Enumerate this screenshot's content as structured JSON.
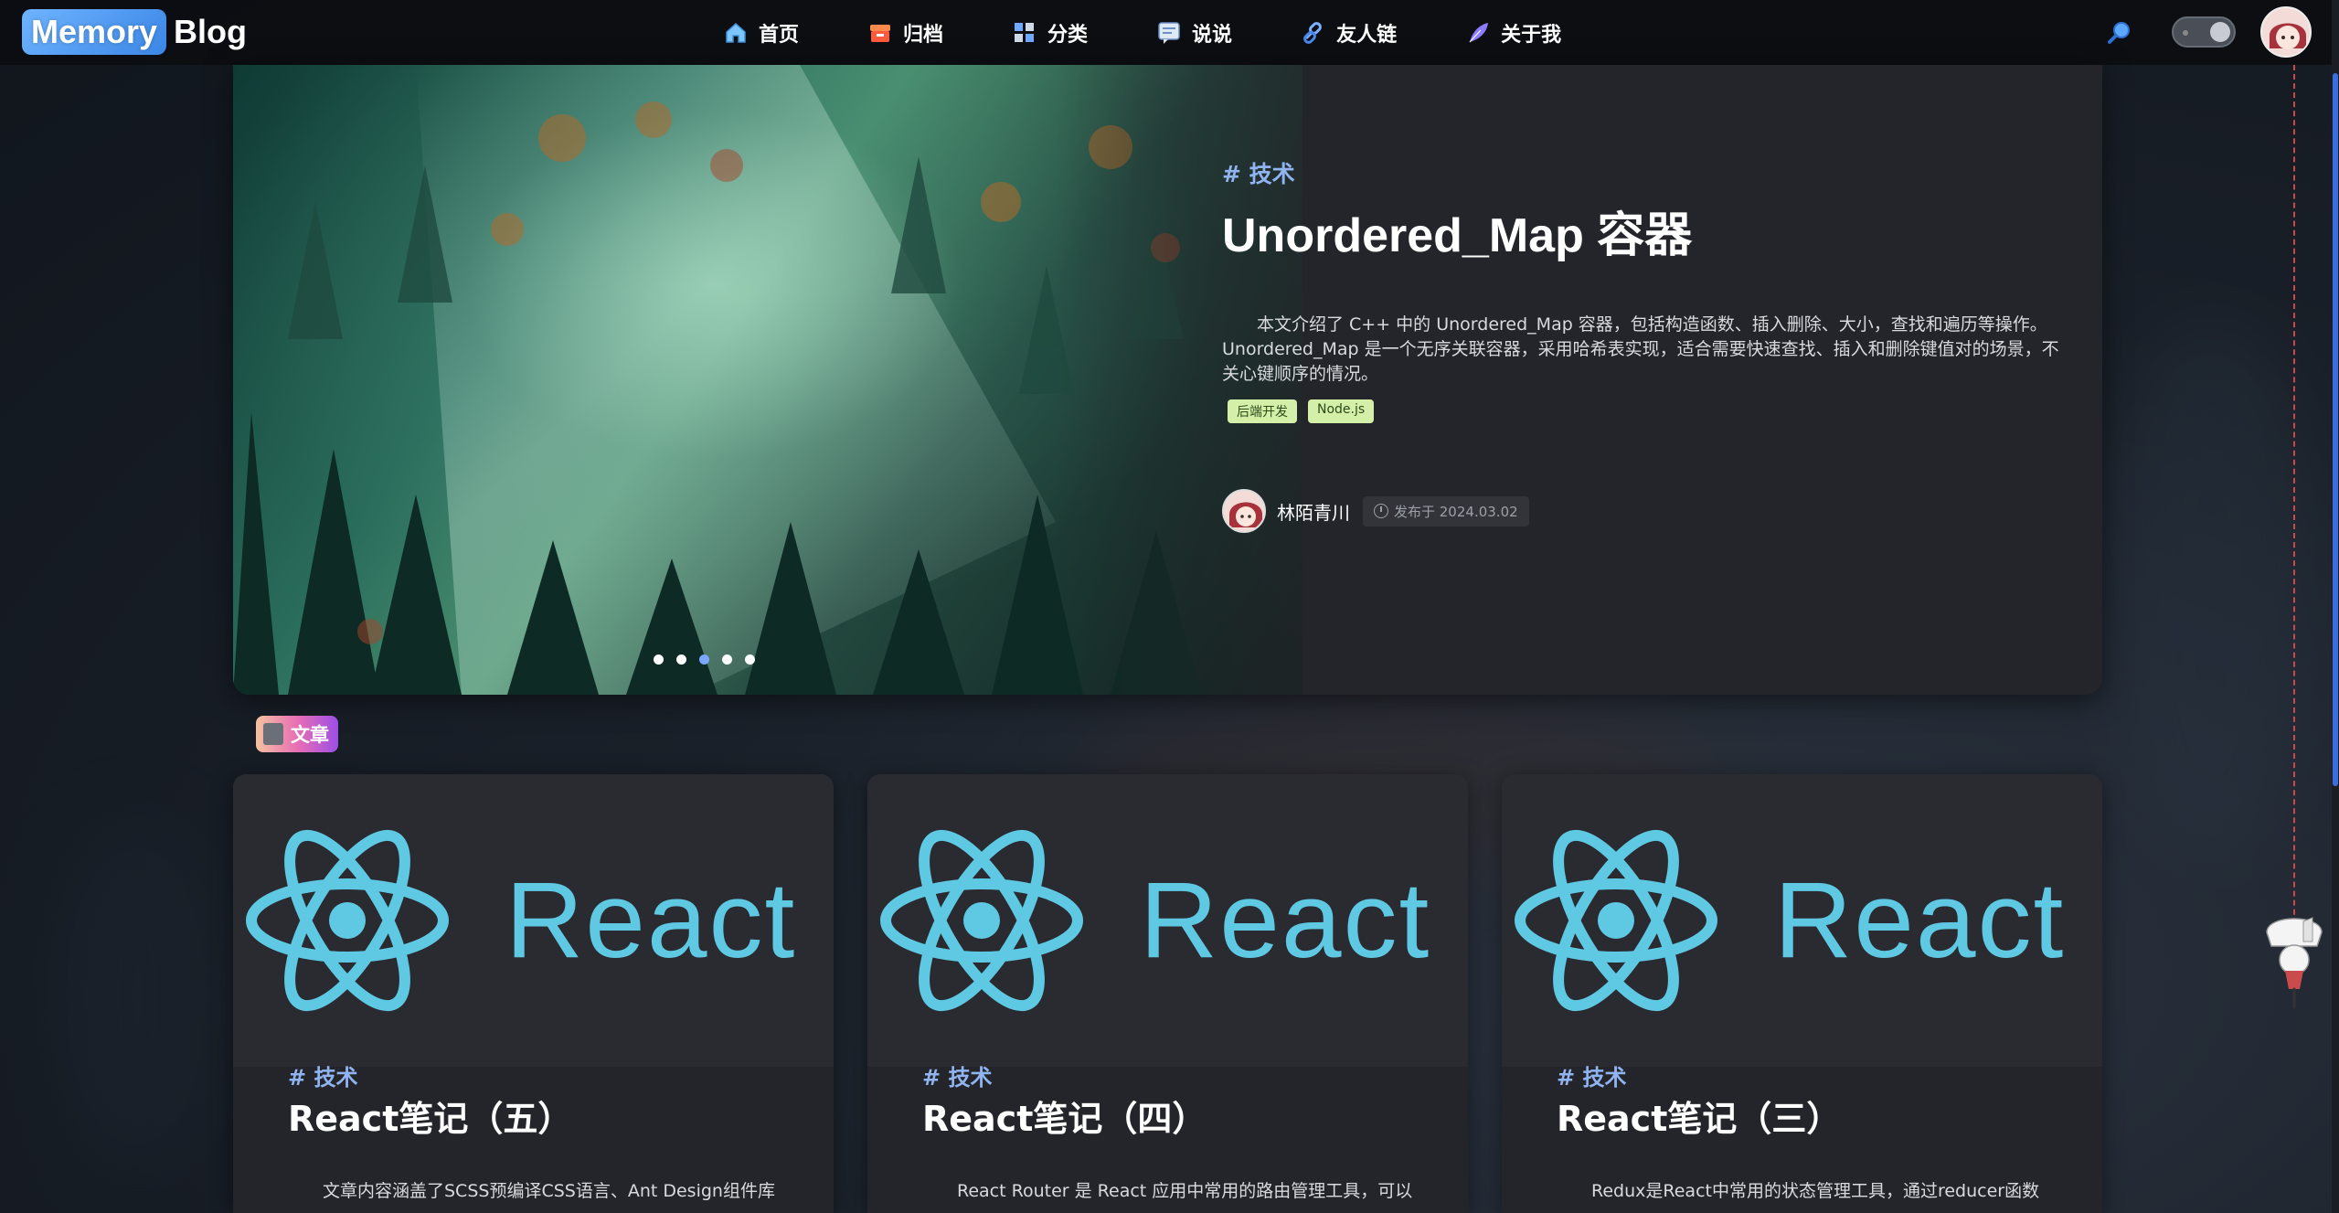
{
  "logo": {
    "box_text": "Memory",
    "text": "Blog"
  },
  "nav": {
    "items": [
      {
        "label": "首页",
        "icon": "home-icon"
      },
      {
        "label": "归档",
        "icon": "archive-icon"
      },
      {
        "label": "分类",
        "icon": "category-icon"
      },
      {
        "label": "说说",
        "icon": "talk-icon"
      },
      {
        "label": "友人链",
        "icon": "link-icon"
      },
      {
        "label": "关于我",
        "icon": "feather-icon"
      }
    ]
  },
  "hero": {
    "category": "# 技术",
    "title": "Unordered_Map 容器",
    "description": "本文介绍了 C++ 中的 Unordered_Map 容器，包括构造函数、插入删除、大小，查找和遍历等操作。Unordered_Map 是一个无序关联容器，采用哈希表实现，适合需要快速查找、插入和删除键值对的场景，不关心键顺序的情况。",
    "tags": [
      "后端开发",
      "Node.js"
    ],
    "author": "林陌青川",
    "date": "发布于 2024.03.02",
    "carousel_total": 5,
    "carousel_active": 3
  },
  "section": {
    "label": "文章"
  },
  "cards": [
    {
      "category": "# 技术",
      "title": "React笔记（五）",
      "cover_word": "React",
      "description": "文章内容涵盖了SCSS预编译CSS语言、Ant Design组件库"
    },
    {
      "category": "# 技术",
      "title": "React笔记（四）",
      "cover_word": "React",
      "description": "React Router 是 React 应用中常用的路由管理工具，可以"
    },
    {
      "category": "# 技术",
      "title": "React笔记（三）",
      "cover_word": "React",
      "description": "Redux是React中常用的状态管理工具，通过reducer函数"
    }
  ],
  "colors": {
    "accent": "#8fb4f0",
    "card_bg": "#24252a",
    "tag_bg": "#d4f0a8",
    "react": "#5fc9e3"
  }
}
